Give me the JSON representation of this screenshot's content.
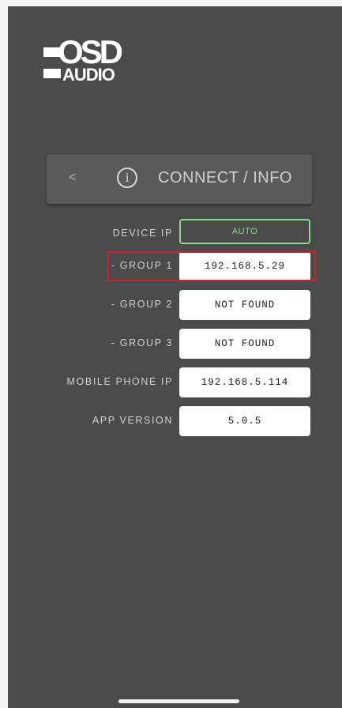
{
  "logo": {
    "top_text": "OSD",
    "bottom_text": "AUDIO"
  },
  "header": {
    "back_glyph": "<",
    "info_glyph": "i",
    "title": "CONNECT / INFO"
  },
  "rows": [
    {
      "label": "DEVICE IP",
      "value": "AUTO"
    },
    {
      "label": "- GROUP 1",
      "value": "192.168.5.29"
    },
    {
      "label": "- GROUP 2",
      "value": "NOT FOUND"
    },
    {
      "label": "- GROUP 3",
      "value": "NOT FOUND"
    },
    {
      "label": "MOBILE PHONE IP",
      "value": "192.168.5.114"
    },
    {
      "label": "APP VERSION",
      "value": "5.0.5"
    }
  ],
  "colors": {
    "background": "#4b4b4b",
    "auto_accent": "#8ed88e",
    "highlight": "#d0202a"
  },
  "icons": [
    "back-chevron-icon",
    "info-icon"
  ]
}
